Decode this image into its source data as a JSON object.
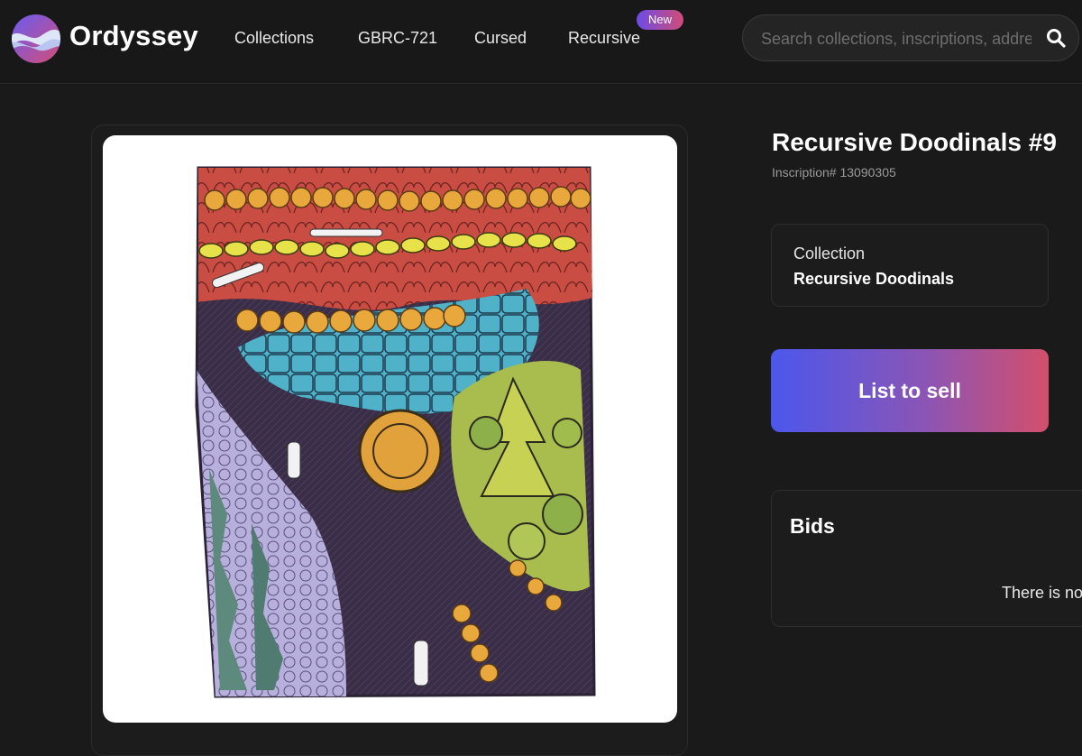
{
  "header": {
    "brand": "Ordyssey",
    "nav": [
      {
        "label": "Collections"
      },
      {
        "label": "GBRC-721"
      },
      {
        "label": "Cursed"
      },
      {
        "label": "Recursive",
        "badge": "New"
      }
    ],
    "search": {
      "placeholder": "Search collections, inscriptions, addresses"
    }
  },
  "inscription": {
    "title": "Recursive Doodinals #9",
    "number_label": "Inscription# 13090305",
    "collection": {
      "label": "Collection",
      "name": "Recursive Doodinals"
    }
  },
  "actions": {
    "list_label": "List to sell"
  },
  "bids": {
    "title": "Bids",
    "empty_text": "There is no"
  },
  "colors": {
    "background": "#1a1a1a",
    "accent_gradient": [
      "#4b57ec",
      "#d34f6b"
    ]
  },
  "icons": {
    "logo": "ordyssey-wave-logo",
    "search": "search-icon"
  }
}
